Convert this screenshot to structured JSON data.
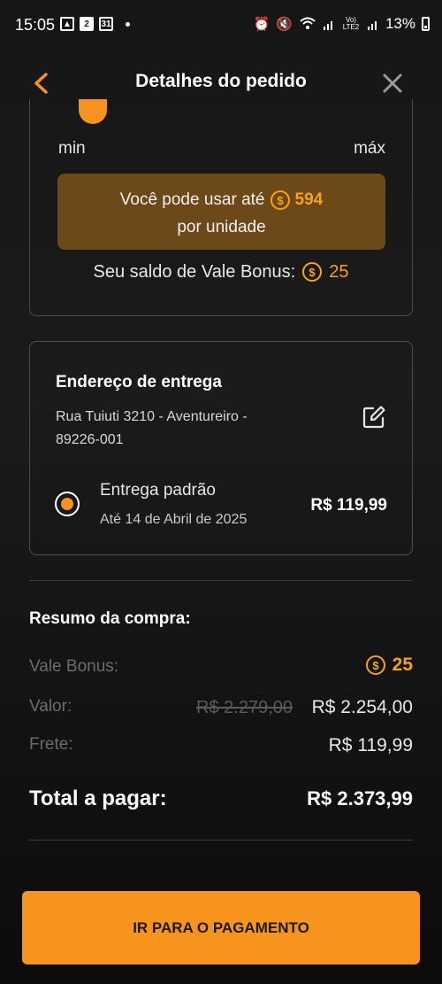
{
  "status_bar": {
    "time": "15:05",
    "notif_badge_a": "2",
    "notif_badge_b": "31",
    "network": "Vo) LTE2",
    "battery": "13%"
  },
  "header": {
    "title": "Detalhes do pedido"
  },
  "limits": {
    "min_label": "min",
    "max_label": "máx",
    "usage_prefix": "Você pode usar até",
    "usage_amount": "594",
    "usage_suffix": "por unidade",
    "balance_prefix": "Seu saldo de Vale Bonus:",
    "balance_amount": "25"
  },
  "delivery": {
    "title": "Endereço de entrega",
    "address": "Rua Tuiuti 3210 - Aventureiro - 89226-001",
    "option_name": "Entrega padrão",
    "option_date": "Até 14 de Abril de 2025",
    "option_price": "R$ 119,99"
  },
  "summary": {
    "title": "Resumo da compra:",
    "bonus_label": "Vale Bonus:",
    "bonus_value": "25",
    "value_label": "Valor:",
    "value_old": "R$ 2.279,00",
    "value_new": "R$ 2.254,00",
    "shipping_label": "Frete:",
    "shipping_value": "R$ 119,99",
    "total_label": "Total a pagar:",
    "total_value": "R$ 2.373,99"
  },
  "actions": {
    "pay_button": "IR PARA O PAGAMENTO"
  },
  "colors": {
    "accent": "#f7941d",
    "usage_bg": "#6d4818"
  }
}
